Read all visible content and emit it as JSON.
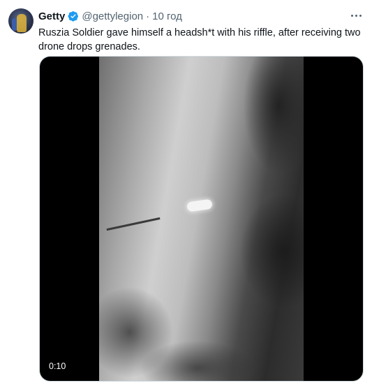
{
  "author": {
    "name": "Getty",
    "handle": "@gettylegion",
    "separator": "·",
    "time": "10 год",
    "verified_icon": "verified-badge-icon",
    "avatar_icon": "avatar-image"
  },
  "tweet": {
    "text": "Ruszia Soldier gave himself a headsh*t with his riffle, after receiving two drone drops grenades."
  },
  "media": {
    "type": "video",
    "timestamp": "0:10"
  },
  "menu": {
    "icon": "more-options-icon"
  },
  "colors": {
    "text": "#0f1419",
    "secondary": "#536471",
    "verified": "#1d9bf0",
    "media_bg": "#000000"
  }
}
